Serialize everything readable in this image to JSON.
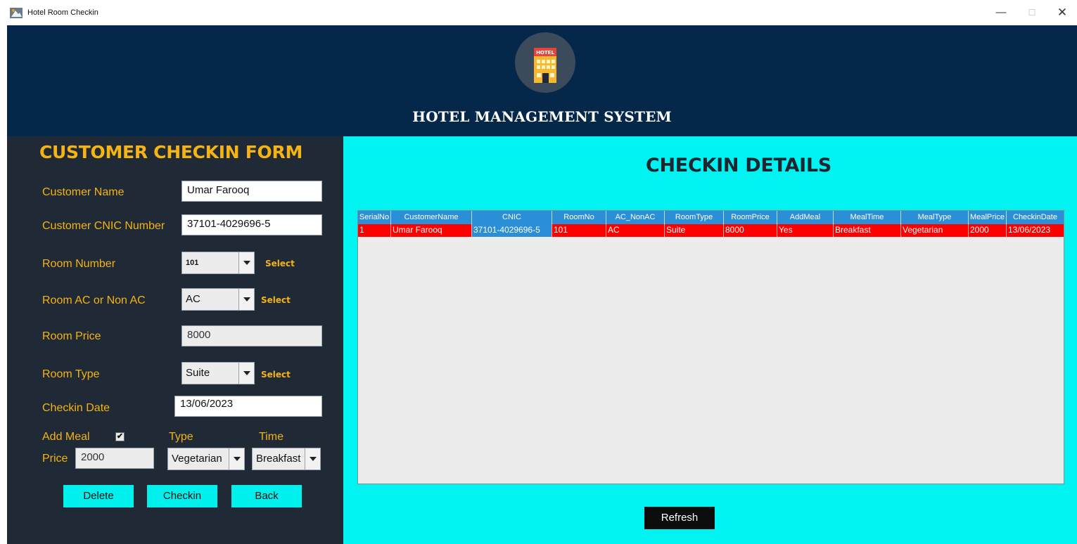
{
  "window": {
    "title": "Hotel Room Checkin",
    "minimize_glyph": "—",
    "maximize_glyph": "☐",
    "close_glyph": "✕"
  },
  "header": {
    "logo_text": "HOTEL",
    "system_title": "HOTEL MANAGEMENT SYSTEM"
  },
  "form": {
    "title": "CUSTOMER CHECKIN FORM",
    "customer_name_label": "Customer Name",
    "customer_name_value": "Umar Farooq",
    "cnic_label": "Customer CNIC Number",
    "cnic_value": "37101-4029696-5",
    "room_number_label": "Room Number",
    "room_number_value": "101",
    "room_ac_label": "Room AC or Non AC",
    "room_ac_value": "AC",
    "room_price_label": "Room Price",
    "room_price_value": "8000",
    "room_type_label": "Room Type",
    "room_type_value": "Suite",
    "checkin_date_label": "Checkin Date",
    "checkin_date_value": "13/06/2023",
    "select_label": "Select",
    "add_meal_label": "Add Meal",
    "add_meal_checked": "✔",
    "type_label": "Type",
    "time_label": "Time",
    "price_label": "Price",
    "meal_price_value": "2000",
    "meal_type_value": "Vegetarian",
    "meal_time_value": "Breakfast",
    "delete_button": "Delete",
    "checkin_button": "Checkin",
    "back_button": "Back"
  },
  "details": {
    "title": "CHECKIN DETAILS",
    "columns": [
      "SerialNo",
      "CustomerName",
      "CNIC",
      "RoomNo",
      "AC_NonAC",
      "RoomType",
      "RoomPrice",
      "AddMeal",
      "MealTime",
      "MealType",
      "MealPrice",
      "CheckinDate"
    ],
    "rows": [
      [
        "1",
        "Umar Farooq",
        "37101-4029696-5",
        "101",
        "AC",
        "Suite",
        "8000",
        "Yes",
        "Breakfast",
        "Vegetarian",
        "2000",
        "13/06/2023"
      ]
    ],
    "refresh_button": "Refresh"
  },
  "colors": {
    "header_bg": "#05284a",
    "form_bg": "#1f2a36",
    "accent_gold": "#f5b314",
    "details_bg": "#00f3f0",
    "table_header": "#2a8fd6",
    "selected_row": "#ff0000"
  }
}
